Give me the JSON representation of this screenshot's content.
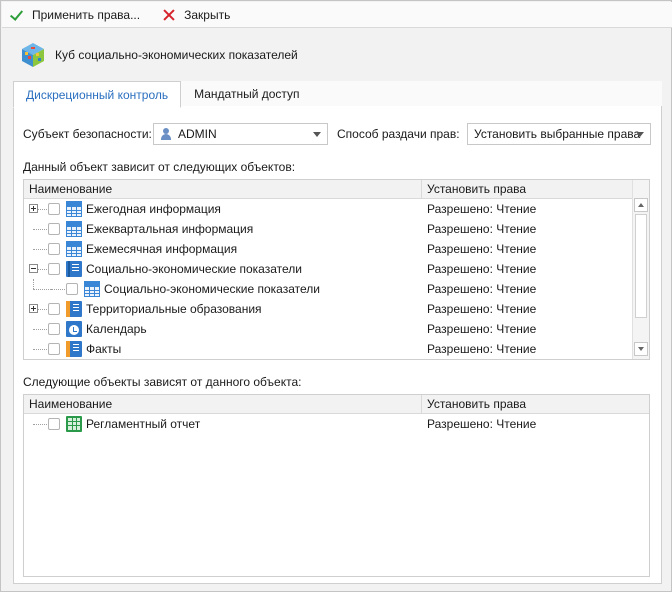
{
  "toolbar": {
    "apply_label": "Применить права...",
    "close_label": "Закрыть"
  },
  "header": {
    "title": "Куб социально-экономических показателей"
  },
  "tabs": [
    {
      "label": "Дискреционный контроль",
      "active": true
    },
    {
      "label": "Мандатный доступ",
      "active": false
    }
  ],
  "form": {
    "subject_label": "Субъект безопасности:",
    "subject_value": "ADMIN",
    "method_label": "Способ раздачи прав:",
    "method_value": "Установить выбранные права"
  },
  "depends_on": {
    "caption": "Данный объект зависит от следующих объектов:",
    "columns": [
      "Наименование",
      "Установить права"
    ],
    "rows": [
      {
        "name": "Ежегодная информация",
        "rights": "Разрешено: Чтение",
        "icon": "table-icon",
        "level": 0,
        "expander": "plus"
      },
      {
        "name": "Ежеквартальная информация",
        "rights": "Разрешено: Чтение",
        "icon": "table-icon",
        "level": 0,
        "expander": ""
      },
      {
        "name": "Ежемесячная информация",
        "rights": "Разрешено: Чтение",
        "icon": "table-icon",
        "level": 0,
        "expander": ""
      },
      {
        "name": "Социально-экономические показатели",
        "rights": "Разрешено: Чтение",
        "icon": "dictionary-icon",
        "level": 0,
        "expander": "minus"
      },
      {
        "name": "Социально-экономические показатели",
        "rights": "Разрешено: Чтение",
        "icon": "table-icon",
        "level": 1,
        "expander": ""
      },
      {
        "name": "Территориальные образования",
        "rights": "Разрешено: Чтение",
        "icon": "dictionary-orange-icon",
        "level": 0,
        "expander": "plus"
      },
      {
        "name": "Календарь",
        "rights": "Разрешено: Чтение",
        "icon": "calendar-icon",
        "level": 0,
        "expander": ""
      },
      {
        "name": "Факты",
        "rights": "Разрешено: Чтение",
        "icon": "dictionary-orange-icon",
        "level": 0,
        "expander": ""
      }
    ]
  },
  "dependents": {
    "caption": "Следующие объекты зависят от данного объекта:",
    "columns": [
      "Наименование",
      "Установить права"
    ],
    "rows": [
      {
        "name": "Регламентный отчет",
        "rights": "Разрешено: Чтение",
        "icon": "report-icon",
        "level": 0,
        "expander": ""
      }
    ]
  },
  "colors": {
    "accent": "#2a6fbf",
    "apply_check": "#2e9e3a",
    "close_x": "#d6232b"
  }
}
